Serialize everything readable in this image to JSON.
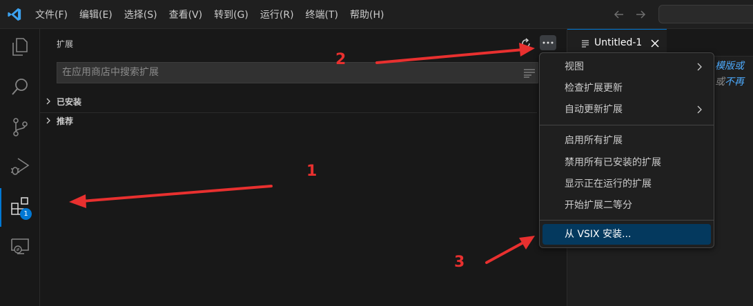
{
  "titlebar": {
    "menus": [
      "文件(F)",
      "编辑(E)",
      "选择(S)",
      "查看(V)",
      "转到(G)",
      "运行(R)",
      "终端(T)",
      "帮助(H)"
    ]
  },
  "activitybar": {
    "icons": [
      "explorer-icon",
      "search-icon",
      "source-control-icon",
      "run-debug-icon",
      "extensions-icon",
      "remote-explorer-icon"
    ],
    "active": "extensions-icon",
    "extensions_badge": "1",
    "accent_color": "#0078d4"
  },
  "sidebar": {
    "title": "扩展",
    "search_placeholder": "在应用商店中搜索扩展",
    "sections": [
      {
        "label": "已安装"
      },
      {
        "label": "推荐"
      }
    ]
  },
  "editor": {
    "tab_label": "Untitled-1",
    "hint_line1": "模版或",
    "hint_line2_gray": "或",
    "hint_line2_link": "不再"
  },
  "context_menu": {
    "groups": [
      [
        {
          "label": "视图",
          "submenu": true
        },
        {
          "label": "检查扩展更新",
          "submenu": false
        },
        {
          "label": "自动更新扩展",
          "submenu": true
        }
      ],
      [
        {
          "label": "启用所有扩展",
          "submenu": false
        },
        {
          "label": "禁用所有已安装的扩展",
          "submenu": false
        },
        {
          "label": "显示正在运行的扩展",
          "submenu": false
        },
        {
          "label": "开始扩展二等分",
          "submenu": false
        }
      ],
      [
        {
          "label": "从 VSIX 安装...",
          "submenu": false,
          "selected": true
        }
      ]
    ],
    "selected_color": "#04395e"
  },
  "annotations": {
    "labels": [
      "1",
      "2",
      "3"
    ],
    "color": "#e8302f"
  }
}
